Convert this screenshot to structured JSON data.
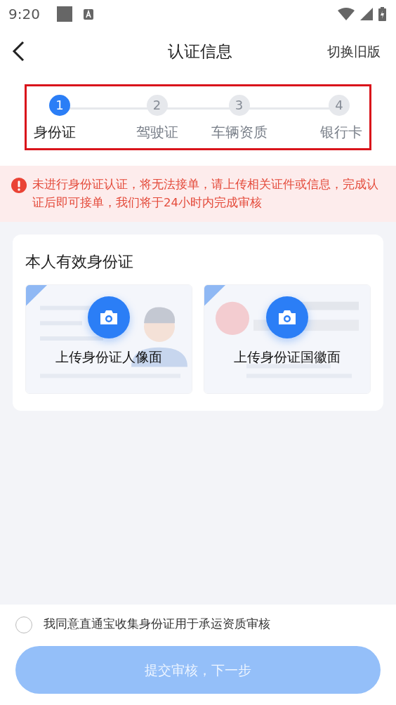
{
  "status_bar": {
    "time": "9:20"
  },
  "header": {
    "title": "认证信息",
    "action": "切换旧版"
  },
  "steps": [
    {
      "number": "1",
      "label": "身份证",
      "selected": true
    },
    {
      "number": "2",
      "label": "驾驶证",
      "selected": false
    },
    {
      "number": "3",
      "label": "车辆资质",
      "selected": false
    },
    {
      "number": "4",
      "label": "银行卡",
      "selected": false
    }
  ],
  "notice": {
    "text": "未进行身份证认证，将无法接单，请上传相关证件或信息，完成认证后即可接单，我们将于24小时内完成审核"
  },
  "section": {
    "title": "本人有效身份证",
    "uploads": [
      {
        "label": "上传身份证人像面",
        "kind": "portrait"
      },
      {
        "label": "上传身份证国徽面",
        "kind": "emblem"
      }
    ]
  },
  "agreement": {
    "text": "我同意直通宝收集身份证用于承运资质审核",
    "checked": false
  },
  "submit": {
    "label": "提交审核，下一步",
    "disabled": true
  }
}
